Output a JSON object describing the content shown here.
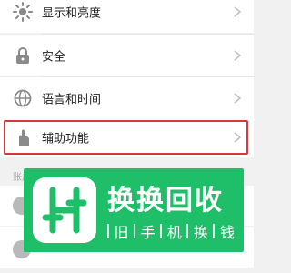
{
  "settings": {
    "items": [
      {
        "label": "显示和亮度",
        "icon": "sun-icon"
      },
      {
        "label": "安全",
        "icon": "lock-icon"
      },
      {
        "label": "语言和时间",
        "icon": "globe-icon"
      },
      {
        "label": "辅助功能",
        "icon": "hand-icon"
      }
    ],
    "section_label": "账户",
    "highlight_color": "#d9363e"
  },
  "watermark": {
    "title": "换换回收",
    "subtitle": [
      "旧",
      "手",
      "机",
      "换",
      "钱"
    ],
    "color": "#1fbf6a",
    "logo": "换换回收 logo"
  }
}
